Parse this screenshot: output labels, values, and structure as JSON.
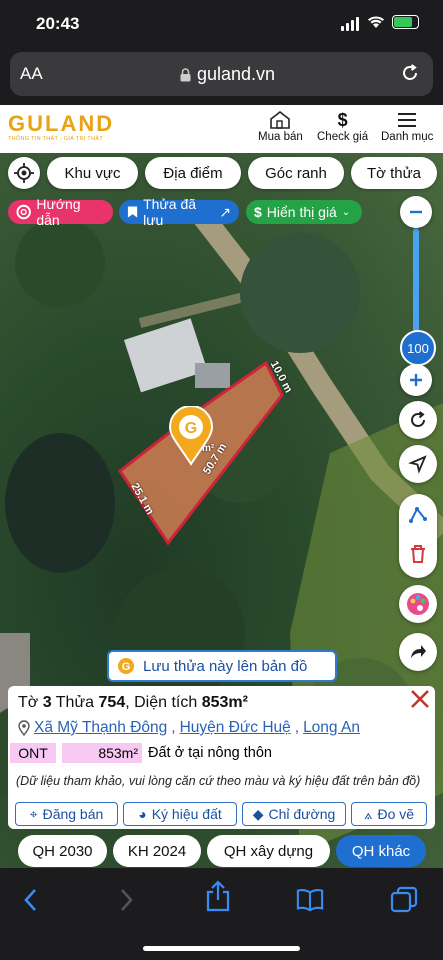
{
  "status": {
    "time": "20:43"
  },
  "browser": {
    "text_size_label": "AA",
    "url": "guland.vn"
  },
  "header": {
    "brand": "GULAND",
    "tagline": "THÔNG TIN THẬT - GIÁ TRỊ THẬT",
    "nav": [
      {
        "label": "Mua bán",
        "icon": "house-icon"
      },
      {
        "label": "Check giá",
        "icon": "dollar-icon"
      },
      {
        "label": "Danh mục",
        "icon": "menu-icon"
      }
    ]
  },
  "filters": [
    "Khu vực",
    "Địa điểm",
    "Góc ranh",
    "Tờ thửa"
  ],
  "pills": {
    "guide": "Hướng dẫn",
    "saved": "Thửa đã lưu",
    "display": "Hiển thị giá"
  },
  "zoom": {
    "value": "100"
  },
  "parcel_edges": {
    "top": "10.0 m",
    "right": "50.7 m",
    "left": "25.1 m",
    "area_suffix": "m²"
  },
  "save_parcel": "Lưu thửa này lên bản đồ",
  "parcel": {
    "to_label": "Tờ",
    "to": "3",
    "thua_label": "Thửa",
    "thua": "754",
    "area_label": "Diện tích",
    "area": "853m²",
    "commune": "Xã Mỹ Thạnh Đông",
    "district": "Huyện Đức Huệ",
    "province": "Long An",
    "land_code": "ONT",
    "land_area": "853m²",
    "land_desc": "Đất ở tại nông thôn",
    "note": "(Dữ liệu tham khảo, vui lòng căn cứ theo màu và ký hiệu đất trên bản đồ)"
  },
  "actions": [
    "Đăng bán",
    "Ký hiệu đất",
    "Chỉ đường",
    "Đo vẽ"
  ],
  "plan_tabs": [
    "QH 2030",
    "KH 2024",
    "QH xây dựng",
    "QH khác"
  ],
  "colors": {
    "brand": "#e8a317",
    "accent": "#1e6fd0",
    "parcel_fill": "#c77a52",
    "parcel_stroke": "#e0203a",
    "ont_badge": "#f6c8f2"
  }
}
